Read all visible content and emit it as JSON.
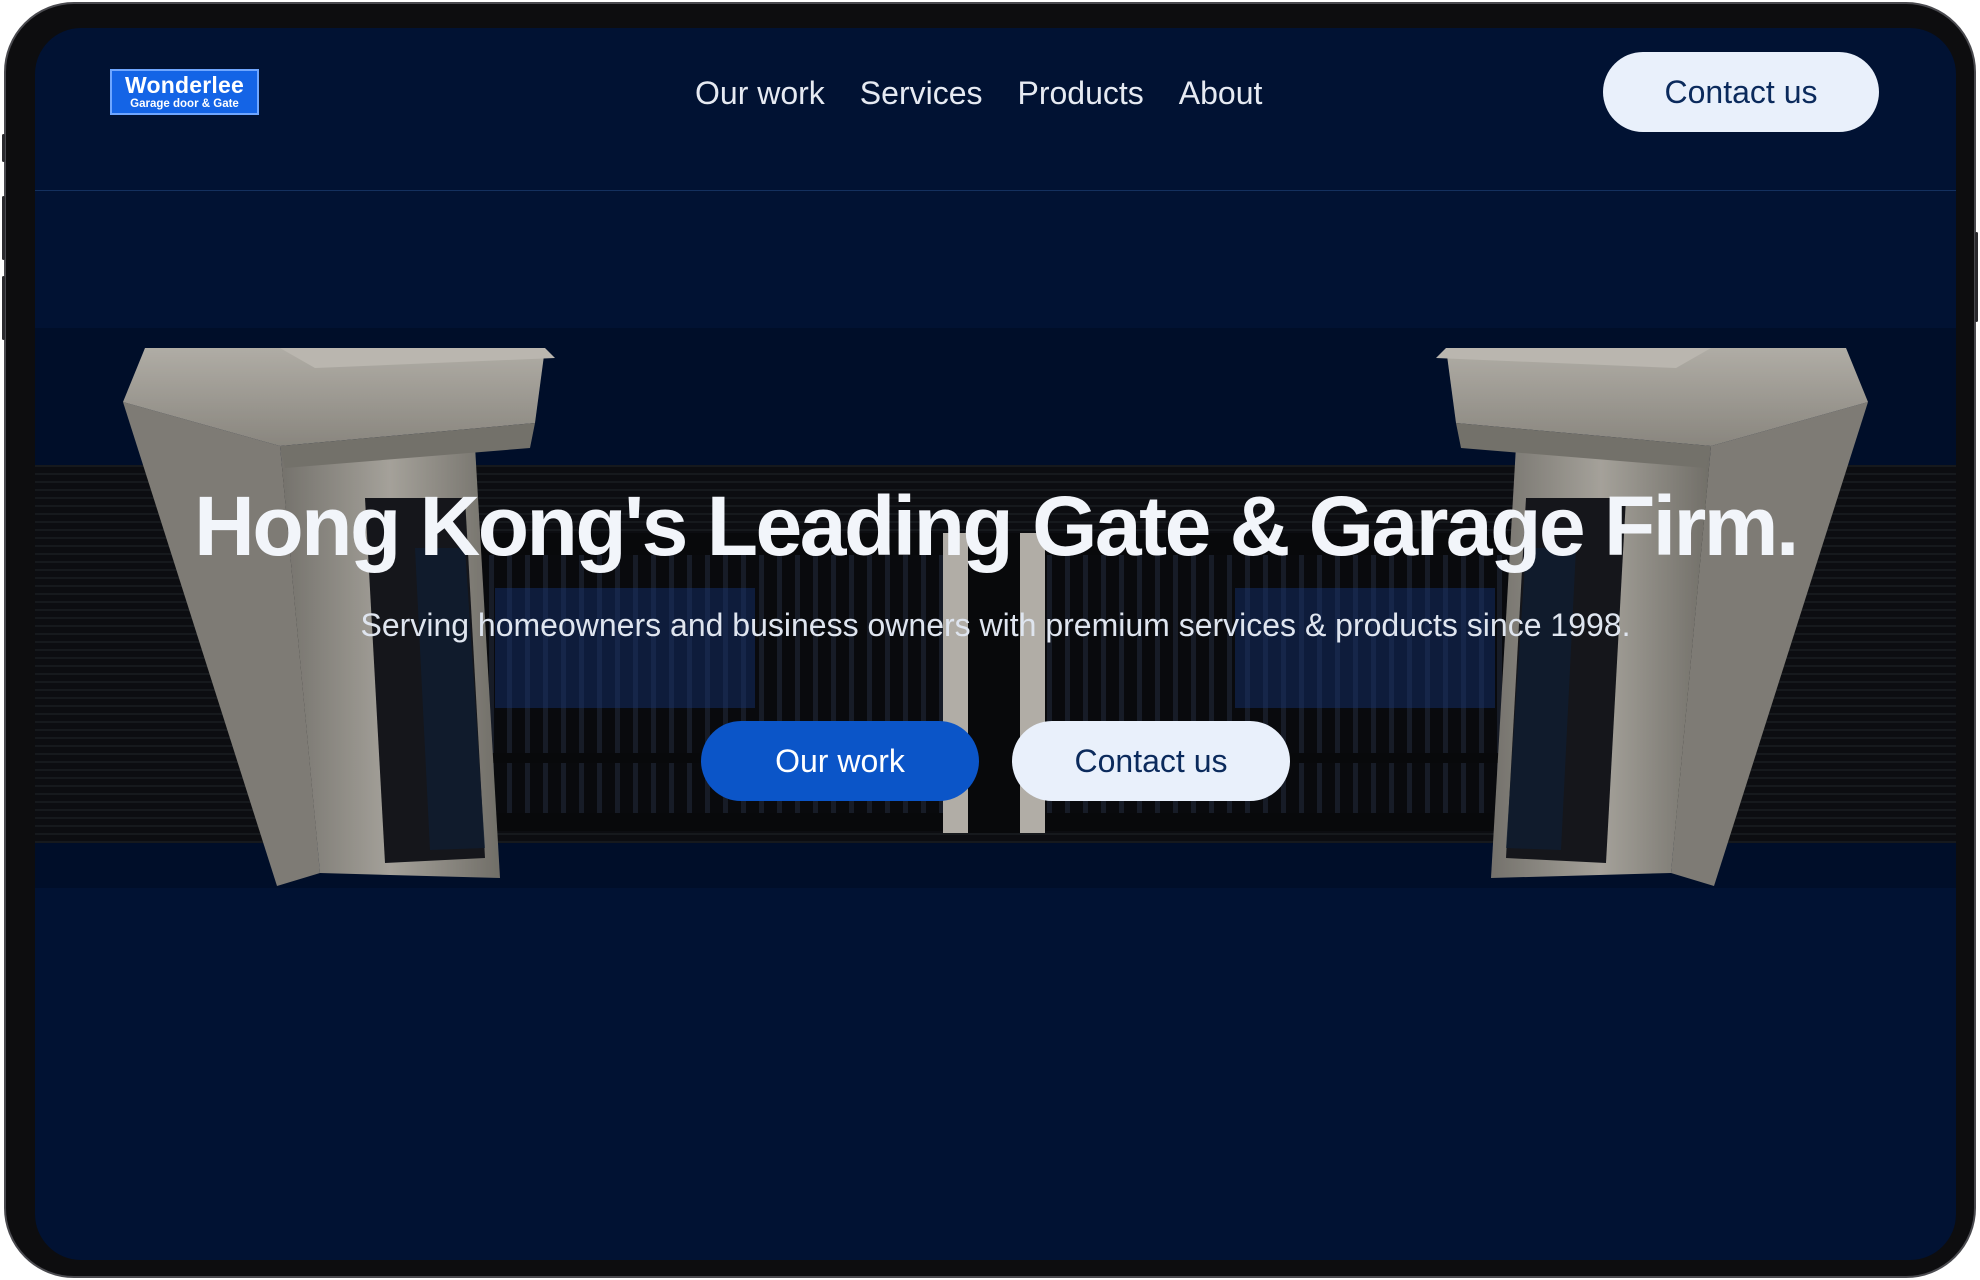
{
  "logo": {
    "name": "Wonderlee",
    "tagline": "Garage door & Gate"
  },
  "nav": {
    "items": [
      {
        "label": "Our work"
      },
      {
        "label": "Services"
      },
      {
        "label": "Products"
      },
      {
        "label": "About"
      }
    ],
    "cta_label": "Contact us"
  },
  "hero": {
    "title": "Hong Kong's Leading Gate & Garage Firm.",
    "subtitle": "Serving homeowners and business owners with premium services & products since 1998.",
    "primary_button": "Our work",
    "secondary_button": "Contact us"
  },
  "colors": {
    "background": "#011233",
    "accent_blue": "#0b55c8",
    "light_button": "#e9f0fb",
    "logo_blue": "#1464e6"
  }
}
